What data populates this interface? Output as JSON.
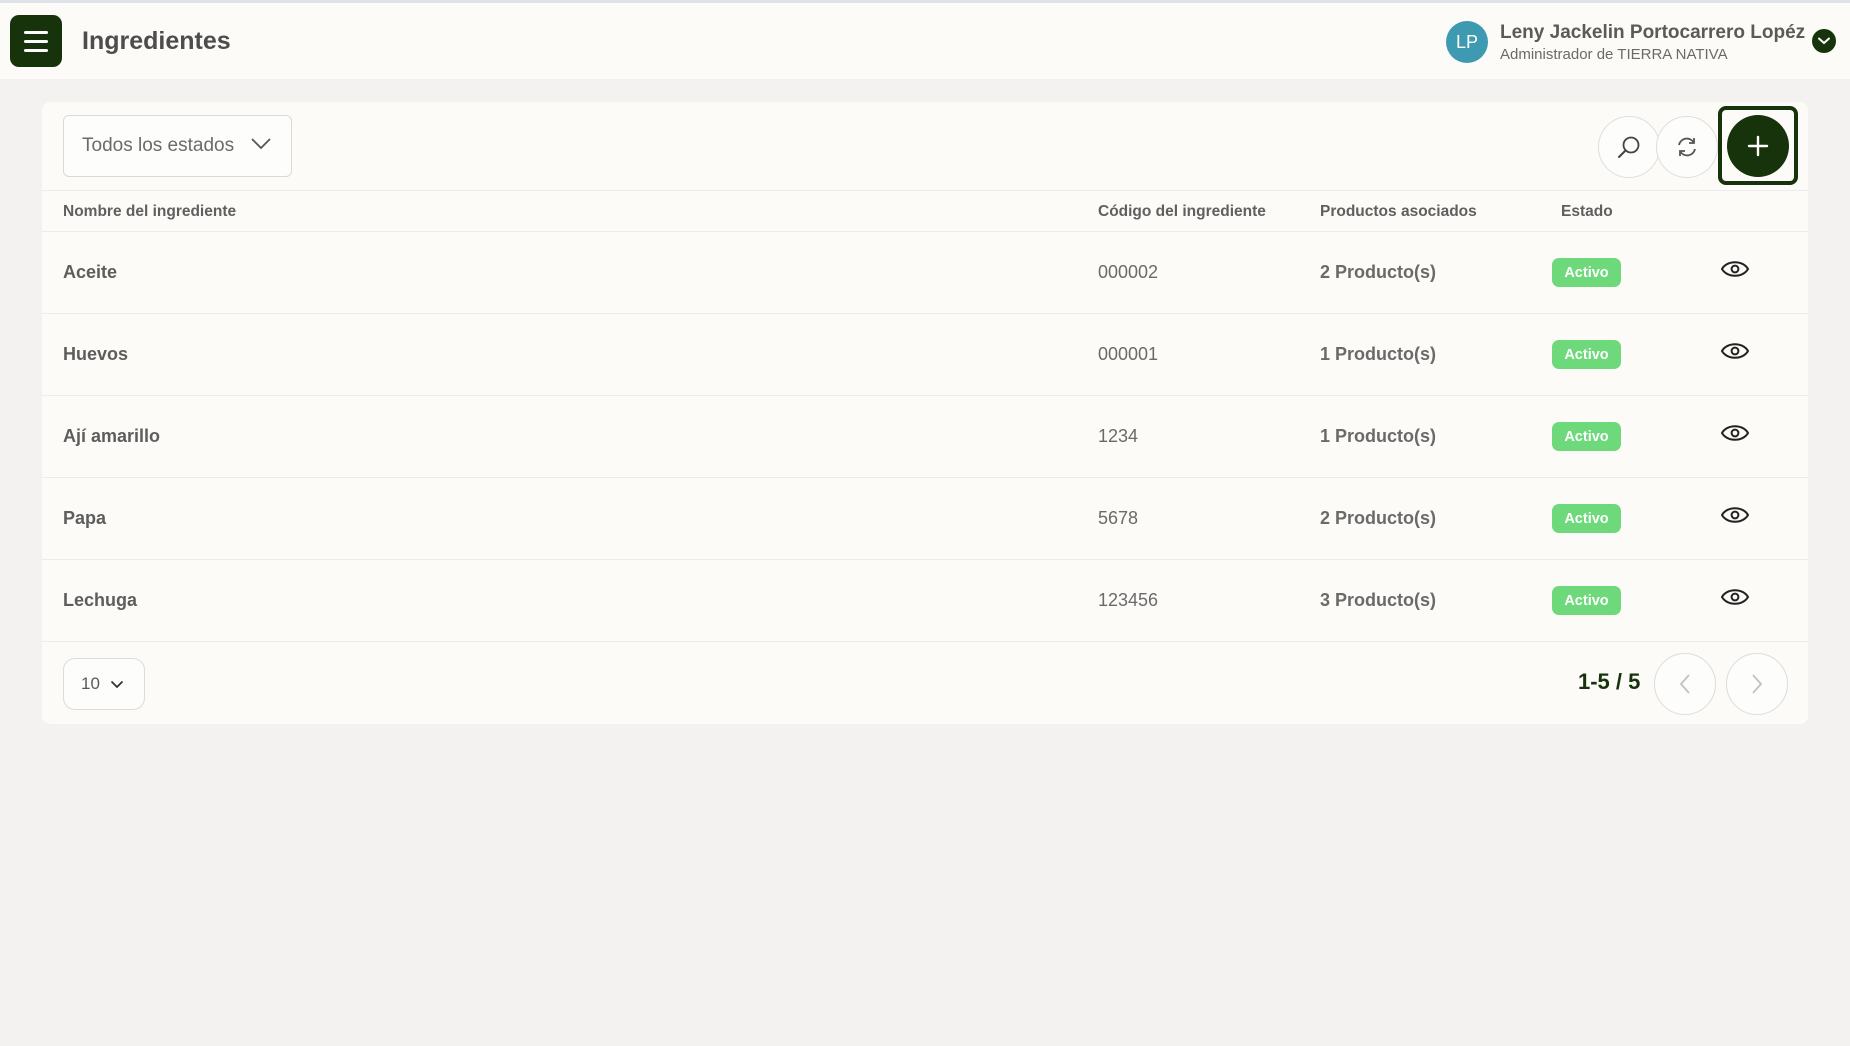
{
  "header": {
    "title": "Ingredientes",
    "user": {
      "initials": "LP",
      "name": "Leny Jackelin Portocarrero Lopéz",
      "role": "Administrador de TIERRA NATIVA"
    }
  },
  "toolbar": {
    "filter_label": "Todos los estados",
    "icons": [
      "search-icon",
      "refresh-icon",
      "plus-icon"
    ]
  },
  "table": {
    "columns": [
      "Nombre del ingrediente",
      "Código del ingrediente",
      "Productos asociados",
      "Estado"
    ],
    "rows": [
      {
        "name": "Aceite",
        "code": "000002",
        "products": "2 Producto(s)",
        "status": "Activo"
      },
      {
        "name": "Huevos",
        "code": "000001",
        "products": "1 Producto(s)",
        "status": "Activo"
      },
      {
        "name": "Ají amarillo",
        "code": "1234",
        "products": "1 Producto(s)",
        "status": "Activo"
      },
      {
        "name": "Papa",
        "code": "5678",
        "products": "2 Producto(s)",
        "status": "Activo"
      },
      {
        "name": "Lechuga",
        "code": "123456",
        "products": "3 Producto(s)",
        "status": "Activo"
      }
    ]
  },
  "pagination": {
    "per_page": "10",
    "range": "1-5 / 5"
  },
  "colors": {
    "brand": "#16330c",
    "badge_active": "#6dd97b",
    "avatar": "#3e9ab0"
  }
}
